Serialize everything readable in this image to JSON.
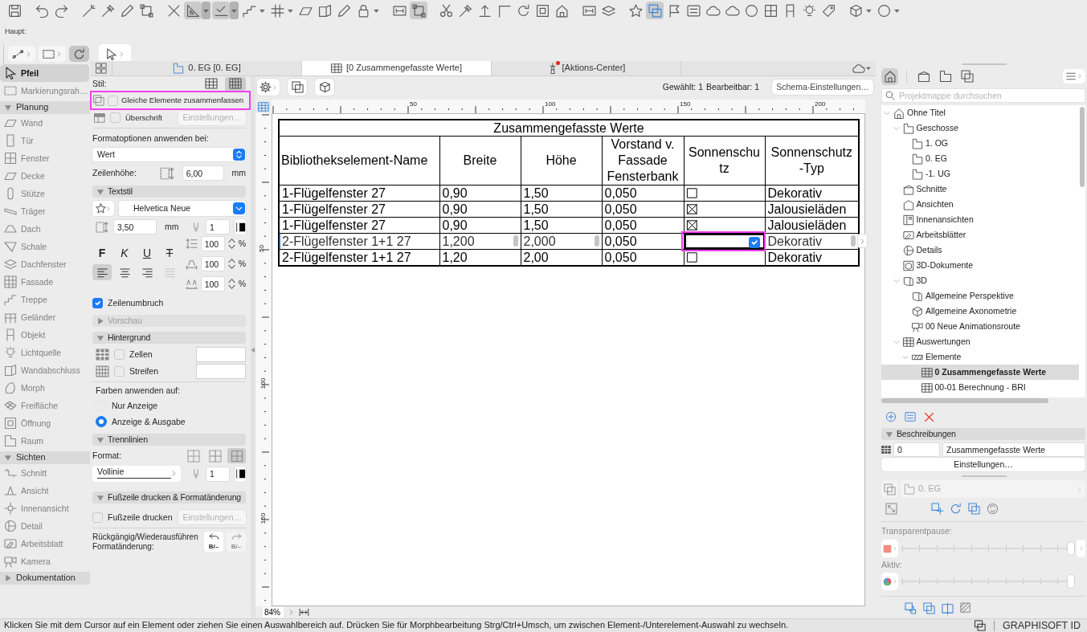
{
  "toolbar": [
    {
      "pressed": false
    },
    {
      "pressed": false
    },
    {
      "pressed": false
    },
    {
      "pressed": false
    },
    {
      "pressed": false
    },
    {
      "pressed": false
    },
    {
      "pressed": false
    },
    {
      "pressed": false
    },
    {
      "pressed": true
    },
    {
      "pressed": true
    },
    {
      "pressed": false
    },
    {
      "pressed": false
    },
    {
      "pressed": false
    },
    {
      "pressed": false
    },
    {
      "pressed": false
    },
    {
      "pressed": false
    },
    {
      "pressed": false
    },
    {
      "pressed": true
    },
    {
      "pressed": false
    },
    {
      "pressed": false
    },
    {
      "pressed": false
    },
    {
      "pressed": false
    },
    {
      "pressed": false
    },
    {
      "pressed": false
    },
    {
      "pressed": false
    },
    {
      "pressed": false
    },
    {
      "pressed": false
    },
    {
      "pressed": false
    },
    {
      "pressed": true
    },
    {
      "pressed": false
    },
    {
      "pressed": false
    },
    {
      "pressed": false
    },
    {
      "pressed": false
    },
    {
      "pressed": false
    },
    {
      "pressed": false
    },
    {
      "pressed": false
    },
    {
      "pressed": false
    },
    {
      "pressed": false
    },
    {
      "pressed": false
    },
    {
      "pressed": false
    }
  ],
  "main_toolbar": {
    "label": "Haupt:",
    "buttons": [
      {
        "pressed": false
      },
      {
        "pressed": false
      },
      {
        "pressed": true
      },
      {
        "pressed": false
      }
    ]
  },
  "toolbox": {
    "tools": [
      {
        "label": "Pfeil",
        "selected": true
      },
      {
        "label": "Markierungsrah…",
        "selected": false
      }
    ],
    "groups": [
      {
        "label": "Planung",
        "expanded": true,
        "tools": [
          {
            "label": "Wand",
            "selected": false
          },
          {
            "label": "Tür",
            "selected": false
          },
          {
            "label": "Fenster",
            "selected": false
          },
          {
            "label": "Decke",
            "selected": false
          },
          {
            "label": "Stütze",
            "selected": false
          },
          {
            "label": "Träger",
            "selected": false
          },
          {
            "label": "Dach",
            "selected": false
          },
          {
            "label": "Schale",
            "selected": false
          },
          {
            "label": "Dachfenster",
            "selected": false
          },
          {
            "label": "Fassade",
            "selected": false
          },
          {
            "label": "Treppe",
            "selected": false
          },
          {
            "label": "Geländer",
            "selected": false
          },
          {
            "label": "Objekt",
            "selected": false
          },
          {
            "label": "Lichtquelle",
            "selected": false
          },
          {
            "label": "Wandabschluss",
            "selected": false
          },
          {
            "label": "Morph",
            "selected": false
          },
          {
            "label": "Freifläche",
            "selected": false
          },
          {
            "label": "Öffnung",
            "selected": false
          },
          {
            "label": "Raum",
            "selected": false
          }
        ]
      },
      {
        "label": "Sichten",
        "expanded": true,
        "tools": [
          {
            "label": "Schnitt",
            "selected": false
          },
          {
            "label": "Ansicht",
            "selected": false
          },
          {
            "label": "Innenansicht",
            "selected": false
          },
          {
            "label": "Detail",
            "selected": false
          },
          {
            "label": "Arbeitsblatt",
            "selected": false
          },
          {
            "label": "Kamera",
            "selected": false
          }
        ]
      },
      {
        "label": "Dokumentation",
        "expanded": false
      }
    ]
  },
  "tabs": [
    {
      "kind": "story",
      "label": "0. EG [0. EG]",
      "selected": false,
      "alert": false
    },
    {
      "kind": "schedule",
      "label": "[0 Zusammengefasste Werte]",
      "selected": true,
      "alert": false
    },
    {
      "kind": "action_center",
      "label": "[Aktions-Center]",
      "selected": false,
      "alert": true
    }
  ],
  "format_panel": {
    "style": {
      "label": "Stil:",
      "options": [
        {
          "selected": false
        },
        {
          "selected": true
        }
      ]
    },
    "options": [
      {
        "label": "Gleiche Elemente zusammenfassen",
        "checked": false,
        "highlighted": true
      },
      {
        "label": "Überschrift",
        "checked": false,
        "highlighted": false,
        "button": {
          "label": "Einstellungen…",
          "disabled": true
        }
      }
    ],
    "apply": {
      "label": "Formatoptionen anwenden bei:",
      "value": "Wert"
    },
    "row_height": {
      "label": "Zeilenhöhe:",
      "value": "6,00",
      "unit": "mm"
    },
    "text_style": {
      "title": "Textstil",
      "expanded": true,
      "font": "Helvetica Neue",
      "size": "3,50",
      "unit": "mm",
      "pen": "1",
      "styles": [
        {
          "label": "F",
          "selected": false
        },
        {
          "label": "K",
          "selected": false
        },
        {
          "label": "U",
          "selected": false
        },
        {
          "label": "T",
          "selected": false
        }
      ],
      "alignments": [
        {
          "selected": true,
          "disabled": false
        },
        {
          "selected": false,
          "disabled": false
        },
        {
          "selected": false,
          "disabled": false
        },
        {
          "selected": false,
          "disabled": true
        }
      ],
      "spacings": [
        {
          "value": "100",
          "unit": "%"
        },
        {
          "value": "100",
          "unit": "%"
        },
        {
          "value": "100",
          "unit": "%"
        }
      ]
    },
    "wrap": {
      "label": "Zeilenumbruch",
      "checked": true
    },
    "preview": {
      "title": "Vorschau",
      "expanded": false,
      "disabled": true
    },
    "background": {
      "title": "Hintergrund",
      "expanded": true,
      "fills": [
        {
          "label": "Zellen",
          "checked": false
        },
        {
          "label": "Streifen",
          "checked": false
        }
      ],
      "apply_label": "Farben anwenden auf:",
      "targets": [
        {
          "label": "Nur Anzeige",
          "selected": false
        },
        {
          "label": "Anzeige & Ausgabe",
          "selected": true
        }
      ]
    },
    "separators": {
      "title": "Trennlinien",
      "expanded": true,
      "label": "Format:",
      "patterns": [
        {
          "selected": false
        },
        {
          "selected": false
        },
        {
          "selected": true
        }
      ],
      "line_type": "Vollinie",
      "pen": "1"
    },
    "footer": {
      "title": "Fußzeile drucken & Formatänderung",
      "expanded": true,
      "print": {
        "label": "Fußzeile drucken",
        "checked": false
      },
      "button": {
        "label": "Einstellungen…",
        "disabled": true
      },
      "undo_label": "Rückgängig/Wiederausführen Formatänderung:",
      "undo_buttons": [
        {
          "label": "B/–",
          "disabled": false
        },
        {
          "label": "B/–",
          "disabled": true
        }
      ]
    }
  },
  "view_toolbar": {
    "selected_count": "Gewählt: 1",
    "editable_count": "Bearbeitbar: 1",
    "settings_button": "Schema-Einstellungen…"
  },
  "ruler": {
    "horizontal": [
      "50",
      "100",
      "150",
      "200"
    ],
    "vertical": [
      "50",
      "100",
      "150"
    ]
  },
  "table": {
    "title": "Zusammengefasste Werte",
    "columns": [
      {
        "lines": [
          "Bibliothekselement-Name"
        ]
      },
      {
        "lines": [
          "Breite"
        ]
      },
      {
        "lines": [
          "Höhe"
        ]
      },
      {
        "lines": [
          "Vorstand v.",
          "Fassade",
          "Fensterbank"
        ]
      },
      {
        "lines": [
          "Sonnenschu",
          "tz"
        ]
      },
      {
        "lines": [
          "Sonnenschutz",
          "-Typ"
        ]
      }
    ],
    "rows": [
      {
        "name": "1-Flügelfenster 27",
        "breite": "0,90",
        "hoehe": "1,50",
        "vorstand": "0,050",
        "sonnenschutz": false,
        "typ": "Dekorativ",
        "editing": false,
        "highlighted": false
      },
      {
        "name": "1-Flügelfenster 27",
        "breite": "0,90",
        "hoehe": "1,50",
        "vorstand": "0,050",
        "sonnenschutz": true,
        "typ": "Jalousieläden",
        "editing": false,
        "highlighted": false
      },
      {
        "name": "1-Flügelfenster 27",
        "breite": "0,90",
        "hoehe": "1,50",
        "vorstand": "0,050",
        "sonnenschutz": true,
        "typ": "Jalousieläden",
        "editing": false,
        "highlighted": false
      },
      {
        "name": "2-Flügelfenster 1+1 27",
        "breite": "1,200",
        "hoehe": "2,000",
        "vorstand": "0,050",
        "sonnenschutz": true,
        "typ": "Dekorativ",
        "editing": true,
        "highlighted": true
      },
      {
        "name": "2-Flügelfenster 1+1 27",
        "breite": "1,20",
        "hoehe": "2,00",
        "vorstand": "0,050",
        "sonnenschutz": false,
        "typ": "Dekorativ",
        "editing": false,
        "highlighted": false
      }
    ]
  },
  "zoom": "84%",
  "navigator": {
    "views": [
      {
        "selected": true
      },
      {
        "selected": false
      },
      {
        "selected": false
      },
      {
        "selected": false
      }
    ],
    "search": {
      "placeholder": "Projektmappe durchsuchen"
    },
    "tree": [
      {
        "kind": "project",
        "label": "Ohne Titel",
        "expanded": true,
        "selected": false,
        "children": [
          {
            "kind": "stories",
            "label": "Geschosse",
            "expanded": true,
            "selected": false,
            "children": [
              {
                "kind": "story",
                "label": "1. OG",
                "selected": false
              },
              {
                "kind": "story",
                "label": "0. EG",
                "selected": false
              },
              {
                "kind": "story",
                "label": "-1. UG",
                "selected": false
              }
            ]
          },
          {
            "kind": "sections",
            "label": "Schnitte",
            "selected": false
          },
          {
            "kind": "elevations",
            "label": "Ansichten",
            "selected": false
          },
          {
            "kind": "interiors",
            "label": "Innenansichten",
            "selected": false
          },
          {
            "kind": "worksheets",
            "label": "Arbeitsblätter",
            "selected": false
          },
          {
            "kind": "details",
            "label": "Details",
            "selected": false
          },
          {
            "kind": "documents",
            "label": "3D-Dokumente",
            "selected": false
          },
          {
            "kind": "model",
            "label": "3D",
            "expanded": true,
            "selected": false,
            "children": [
              {
                "kind": "perspective",
                "label": "Allgemeine Perspektive",
                "selected": false
              },
              {
                "kind": "axonometry",
                "label": "Allgemeine Axonometrie",
                "selected": false
              },
              {
                "kind": "path",
                "label": "00 Neue Animationsroute",
                "selected": false
              }
            ]
          },
          {
            "kind": "schedules",
            "label": "Auswertungen",
            "expanded": true,
            "selected": false,
            "children": [
              {
                "kind": "folder",
                "label": "Elemente",
                "expanded": true,
                "selected": false,
                "children": [
                  {
                    "kind": "schedule",
                    "label": "0 Zusammengefasste Werte",
                    "selected": true
                  },
                  {
                    "kind": "schedule",
                    "label": "00-01 Berechnung - BRI",
                    "selected": false
                  }
                ]
              }
            ]
          }
        ]
      }
    ],
    "descriptions": {
      "title": "Beschreibungen",
      "expanded": true,
      "id": "0",
      "name": "Zusammengefasste Werte",
      "button": "Einstellungen…"
    },
    "layer": {
      "value": "0. EG",
      "disabled": true
    },
    "transparency": {
      "label": "Transparentpause:",
      "level": 1
    },
    "activity": {
      "label": "Aktiv:",
      "level": 1
    }
  },
  "status_bar": {
    "message": "Klicken Sie mit dem Cursor auf ein Element oder ziehen Sie einen Auswahlbereich auf. Drücken Sie für Morphbearbeitung Strg/Ctrl+Umsch, um zwischen Element-/Unterelement-Auswahl zu wechseln.",
    "account": "GRAPHISOFT ID"
  }
}
